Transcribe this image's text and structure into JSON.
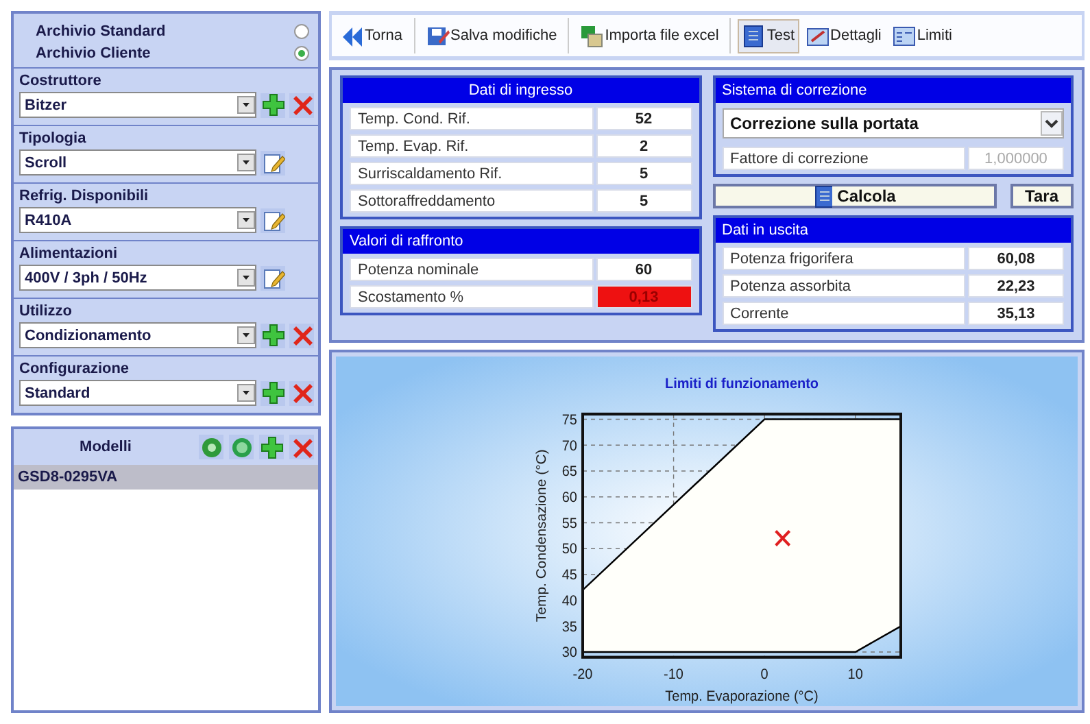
{
  "archive_options": [
    {
      "label": "Archivio Standard",
      "selected": false
    },
    {
      "label": "Archivio Cliente",
      "selected": true
    }
  ],
  "sections": [
    {
      "label": "Costruttore",
      "value": "Bitzer",
      "kind": "add-delete"
    },
    {
      "label": "Tipologia",
      "value": "Scroll",
      "kind": "edit"
    },
    {
      "label": "Refrig. Disponibili",
      "value": "R410A",
      "kind": "edit"
    },
    {
      "label": "Alimentazioni",
      "value": "400V / 3ph / 50Hz",
      "kind": "edit"
    },
    {
      "label": "Utilizzo",
      "value": "Condizionamento",
      "kind": "add-delete"
    },
    {
      "label": "Configurazione",
      "value": "Standard",
      "kind": "add-delete"
    }
  ],
  "models": {
    "title": "Modelli",
    "items": [
      {
        "label": "GSD8-0295VA",
        "selected": true
      }
    ]
  },
  "toolbar": [
    {
      "label": "Torna",
      "kind": "back",
      "selected": false
    },
    {
      "label": "Salva modifiche",
      "kind": "save",
      "selected": false
    },
    {
      "label": "Importa file excel",
      "kind": "import",
      "selected": false
    },
    {
      "label": "Test",
      "kind": "test",
      "selected": true
    },
    {
      "label": "Dettagli",
      "kind": "details",
      "selected": false
    },
    {
      "label": "Limiti",
      "kind": "limits",
      "selected": false
    }
  ],
  "input_data": {
    "title": "Dati di ingresso",
    "rows": [
      {
        "label": "Temp. Cond. Rif.",
        "value": "52"
      },
      {
        "label": "Temp. Evap. Rif.",
        "value": "2"
      },
      {
        "label": "Surriscaldamento Rif.",
        "value": "5"
      },
      {
        "label": "Sottoraffreddamento",
        "value": "5"
      }
    ]
  },
  "comparison": {
    "title": "Valori di raffronto",
    "rows": [
      {
        "label": "Potenza nominale",
        "value": "60",
        "alert": false
      },
      {
        "label": "Scostamento %",
        "value": "0,13",
        "alert": true
      }
    ]
  },
  "correction": {
    "title": "Sistema di correzione",
    "mode": "Correzione sulla portata",
    "factor_label": "Fattore di correzione",
    "factor_value": "1,000000",
    "factor_disabled": true
  },
  "buttons": {
    "calculate": "Calcola",
    "tare": "Tara"
  },
  "output_data": {
    "title": "Dati in uscita",
    "rows": [
      {
        "label": "Potenza frigorifera",
        "value": "60,08"
      },
      {
        "label": "Potenza assorbita",
        "value": "22,23"
      },
      {
        "label": "Corrente",
        "value": "35,13"
      }
    ]
  },
  "chart": {
    "chart_data": {
      "type": "line",
      "title": "Limiti di funzionamento",
      "xlabel": "Temp. Evaporazione (°C)",
      "ylabel": "Temp. Condensazione (°C)",
      "x": [
        -20,
        0,
        2,
        10,
        15
      ],
      "series": [
        {
          "color": "#000000",
          "values": [
            42,
            75,
            75,
            75,
            75
          ]
        },
        {
          "color": "#000000",
          "values": [
            30,
            30,
            30,
            30,
            35
          ]
        },
        {
          "color": "#e02020",
          "marker": "x",
          "values": [
            null,
            null,
            52,
            null,
            null
          ]
        }
      ],
      "xlim": [
        -20,
        15
      ],
      "ylim": [
        29,
        76
      ],
      "xticks": [
        -20,
        -10,
        0,
        10
      ],
      "yticks": [
        30,
        35,
        40,
        45,
        50,
        55,
        60,
        65,
        70,
        75
      ],
      "grid": true
    }
  }
}
